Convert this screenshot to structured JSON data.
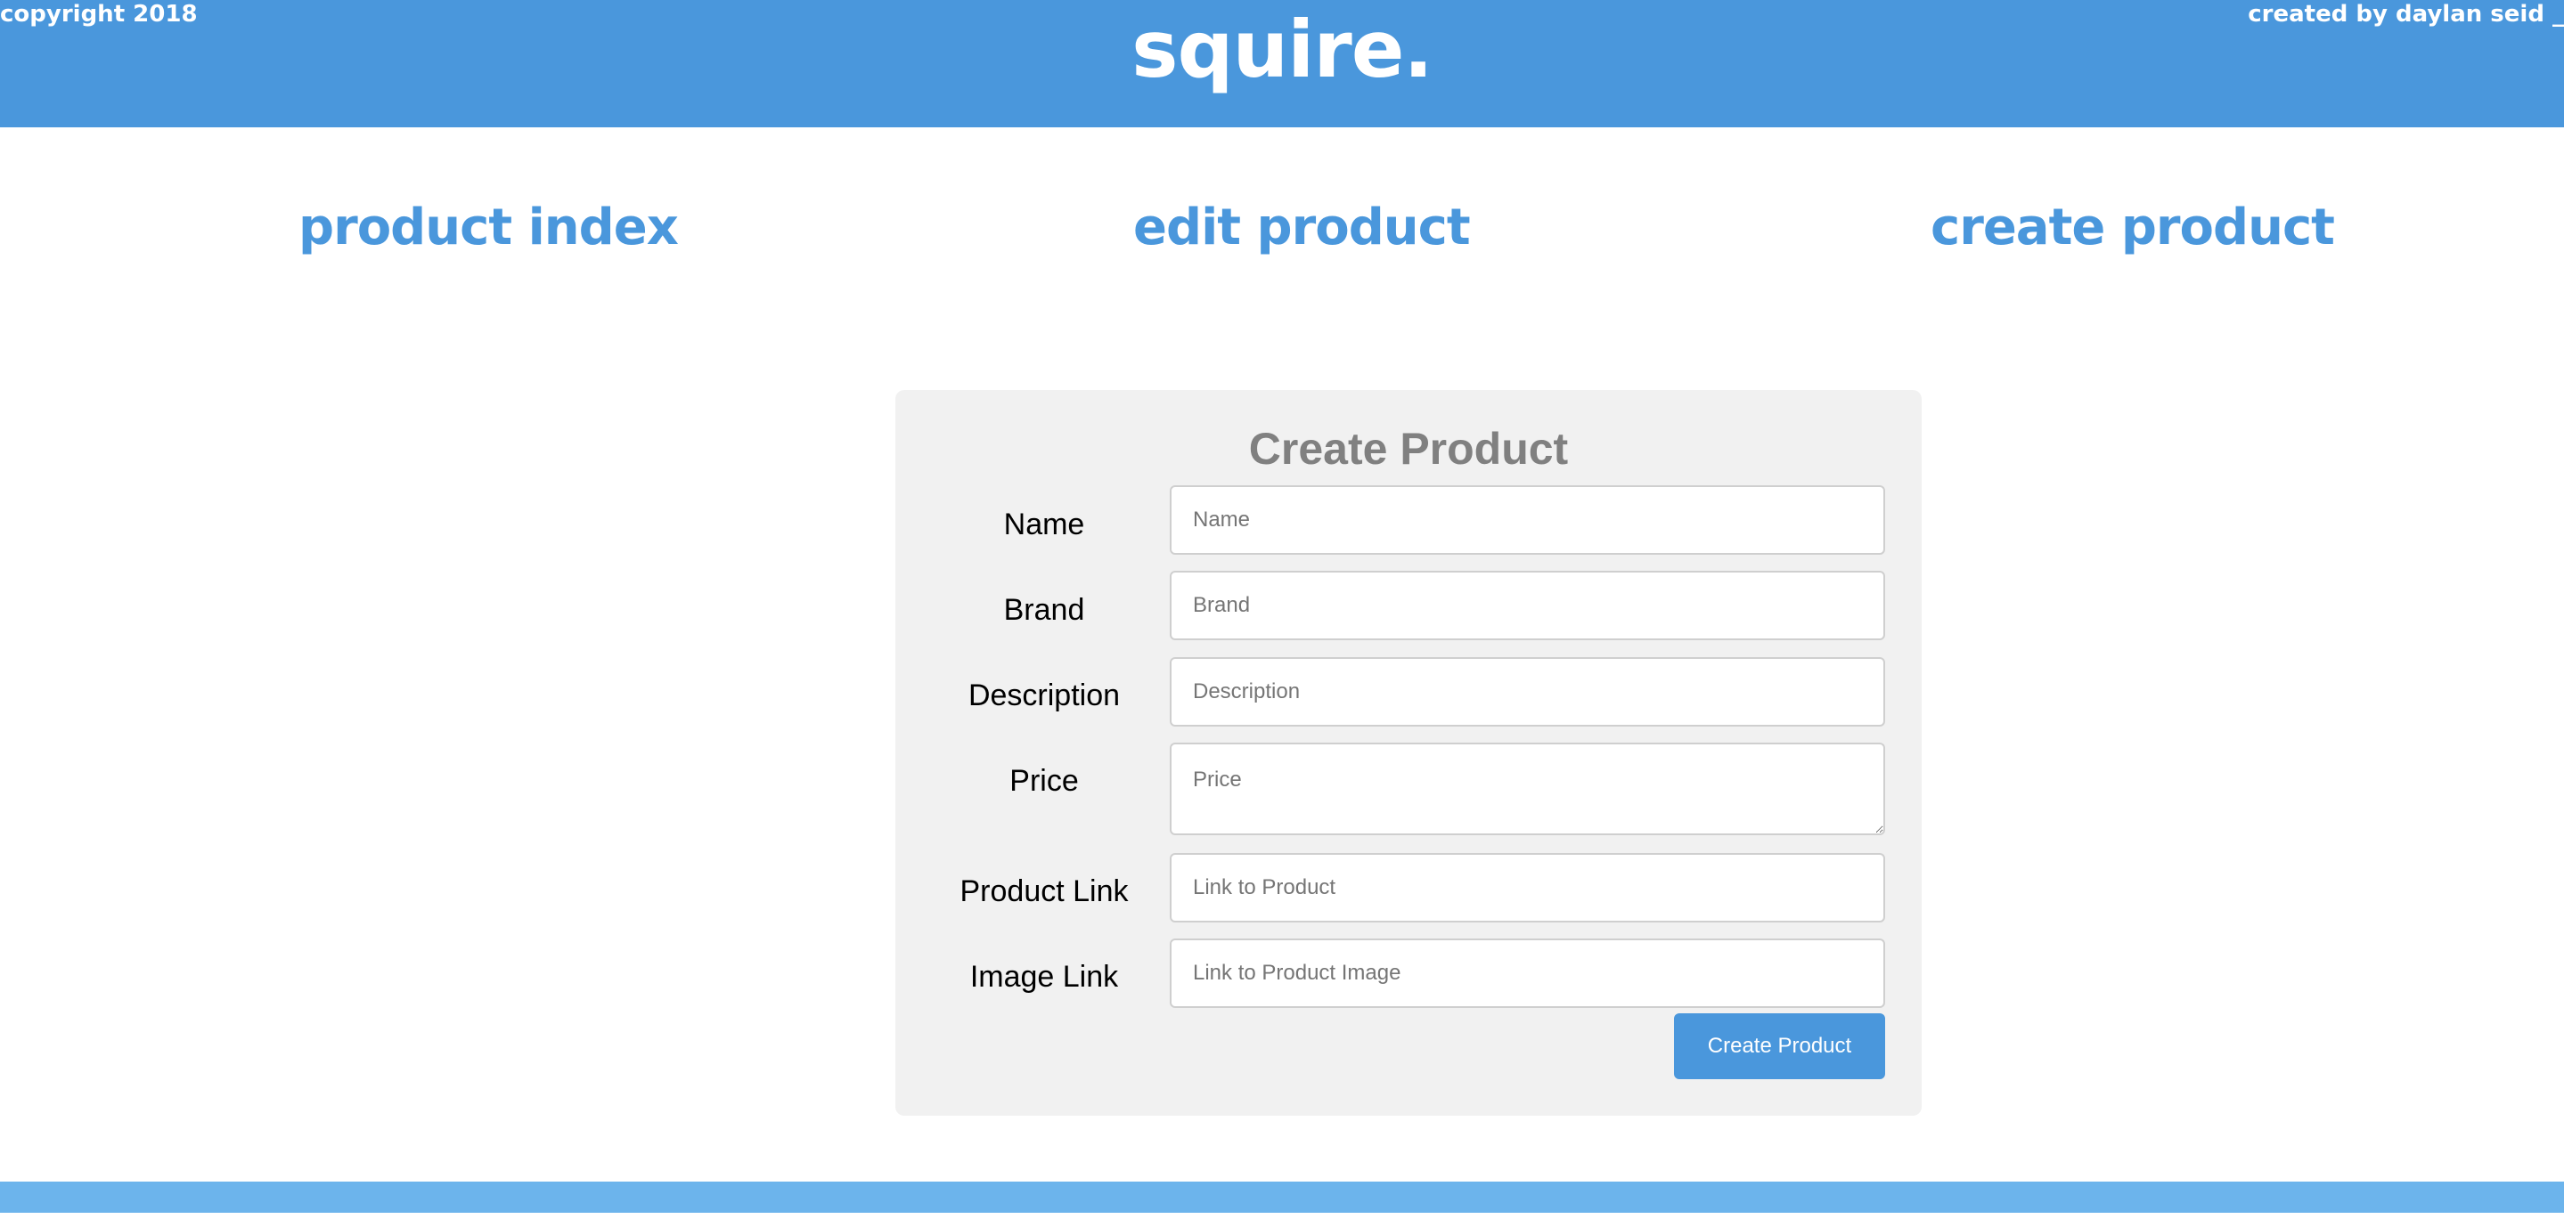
{
  "header": {
    "logo": "squire."
  },
  "nav": {
    "items": [
      {
        "label": "product index"
      },
      {
        "label": "edit product"
      },
      {
        "label": "create product"
      }
    ]
  },
  "form": {
    "title": "Create Product",
    "fields": [
      {
        "label": "Name",
        "placeholder": "Name",
        "value": ""
      },
      {
        "label": "Brand",
        "placeholder": "Brand",
        "value": ""
      },
      {
        "label": "Description",
        "placeholder": "Description",
        "value": ""
      },
      {
        "label": "Price",
        "placeholder": "Price",
        "value": ""
      },
      {
        "label": "Product Link",
        "placeholder": "Link to Product",
        "value": ""
      },
      {
        "label": "Image Link",
        "placeholder": "Link to Product Image",
        "value": ""
      }
    ],
    "submit_label": "Create Product"
  },
  "footer": {
    "left": "copyright 2018",
    "right": "created by daylan seid _"
  },
  "colors": {
    "brand": "#4a97dc",
    "footer": "#6cb4ec",
    "card": "#f1f1f1",
    "title_gray": "#808080"
  }
}
